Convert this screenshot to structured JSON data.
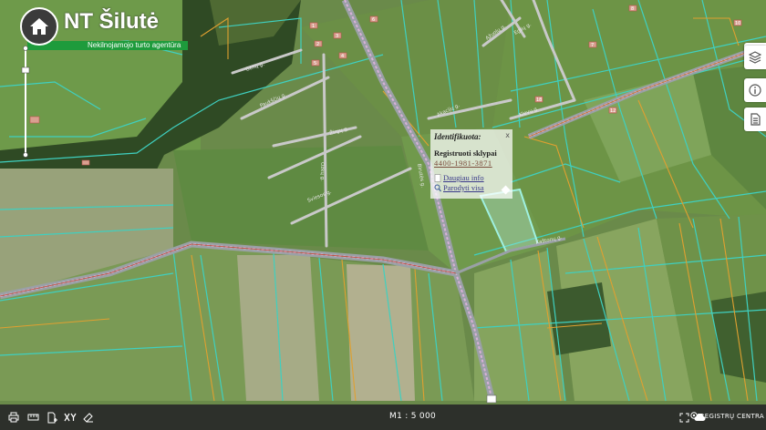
{
  "logo": {
    "brand": "NT Šilutė",
    "tagline": "Nekilnojamojo turto agentūra"
  },
  "popup": {
    "title": "Identifikuota:",
    "close_label": "x",
    "subtitle": "Registruoti sklypai",
    "parcel_code": "4400-1981-3871",
    "more_info_label": "Daugiau info",
    "show_all_label": "Parodyti visa"
  },
  "streets": [
    {
      "name": "Gėlių g."
    },
    {
      "name": "Paukščių g."
    },
    {
      "name": "Žirgų g."
    },
    {
      "name": "Ožkų g."
    },
    {
      "name": "Sviesos g."
    },
    {
      "name": "Akacijų g."
    },
    {
      "name": "Klevų g."
    },
    {
      "name": "Ąžuolų g."
    },
    {
      "name": "Eglių g."
    },
    {
      "name": "Birutės g."
    },
    {
      "name": "Kaštonų g."
    }
  ],
  "house_numbers": [
    "1",
    "2",
    "3",
    "4",
    "5",
    "6",
    "7",
    "8",
    "10",
    "12",
    "18"
  ],
  "bottom_bar": {
    "scale_label": "M1 : 5 000",
    "credit_label": "REGISTRŲ CENTRA"
  },
  "colors": {
    "parcel_border": "#3fd0c0",
    "road": "#c7c7c7",
    "railway": "#e8e0e8",
    "accent_green": "#1e9b3c",
    "highlight": "#9fe8dc"
  }
}
